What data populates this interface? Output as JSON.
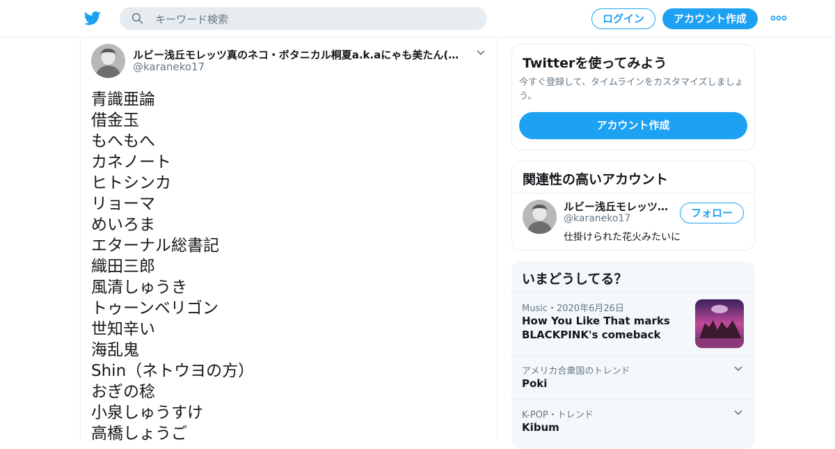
{
  "header": {
    "search_placeholder": "キーワード検索",
    "login_label": "ログイン",
    "signup_label": "アカウント作成"
  },
  "tweet": {
    "author_name": "ルビー浅丘モレッツ真のネコ・ボタニカル桐夏a.k.aにゃも美たん(イ…",
    "author_handle": "@karaneko17",
    "lines": [
      "青識亜論",
      "借金玉",
      "もへもへ",
      "カネノート",
      "ヒトシンカ",
      "リョーマ",
      "めいろま",
      "エターナル総書記",
      "織田三郎",
      "風清しゅうき",
      "トゥーンベリゴン",
      "世知辛い",
      "海乱鬼",
      "Shin（ネトウヨの方）",
      "おぎの稔",
      "小泉しゅうすけ",
      "高橋しょうご"
    ]
  },
  "signup_card": {
    "title": "Twitterを使ってみよう",
    "description": "今すぐ登録して、タイムラインをカスタマイズしましょう。",
    "button_label": "アカウント作成"
  },
  "related": {
    "title": "関連性の高いアカウント",
    "account": {
      "name": "ルビー浅丘モレッツ…",
      "handle": "@karaneko17",
      "bio": "仕掛けられた花火みたいに",
      "follow_label": "フォロー"
    }
  },
  "trends": {
    "title": "いまどうしてる？",
    "items": [
      {
        "meta": "Music・2020年6月26日",
        "title": "How You Like That marks BLACKPINK's comeback"
      },
      {
        "meta": "アメリカ合衆国のトレンド",
        "title": "Poki"
      },
      {
        "meta": "K-POP・トレンド",
        "title": "Kibum"
      }
    ]
  },
  "colors": {
    "accent": "#1da1f2",
    "text": "#14171a",
    "muted": "#657786",
    "border": "#e6ecf0"
  },
  "icons": [
    "twitter-logo-icon",
    "search-icon",
    "more-icon",
    "chevron-down-icon"
  ]
}
